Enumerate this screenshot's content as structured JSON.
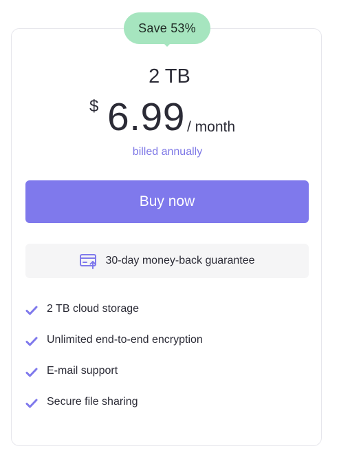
{
  "badge": {
    "text": "Save 53%",
    "color": "#a6e5bf"
  },
  "plan": {
    "name": "2 TB",
    "currency": "$",
    "amount": "6.99",
    "period": "/ month",
    "billing": "billed annually"
  },
  "cta": {
    "label": "Buy now",
    "color": "#7f79ec"
  },
  "guarantee": {
    "icon": "card-refund-icon",
    "text": "30-day money-back guarantee"
  },
  "features": [
    {
      "icon": "check-icon",
      "label": "2 TB cloud storage"
    },
    {
      "icon": "check-icon",
      "label": "Unlimited end-to-end encryption"
    },
    {
      "icon": "check-icon",
      "label": "E-mail support"
    },
    {
      "icon": "check-icon",
      "label": "Secure file sharing"
    }
  ],
  "colors": {
    "accent": "#7f79ec",
    "accent_text": "#7e78e6",
    "text": "#2b2b36"
  }
}
